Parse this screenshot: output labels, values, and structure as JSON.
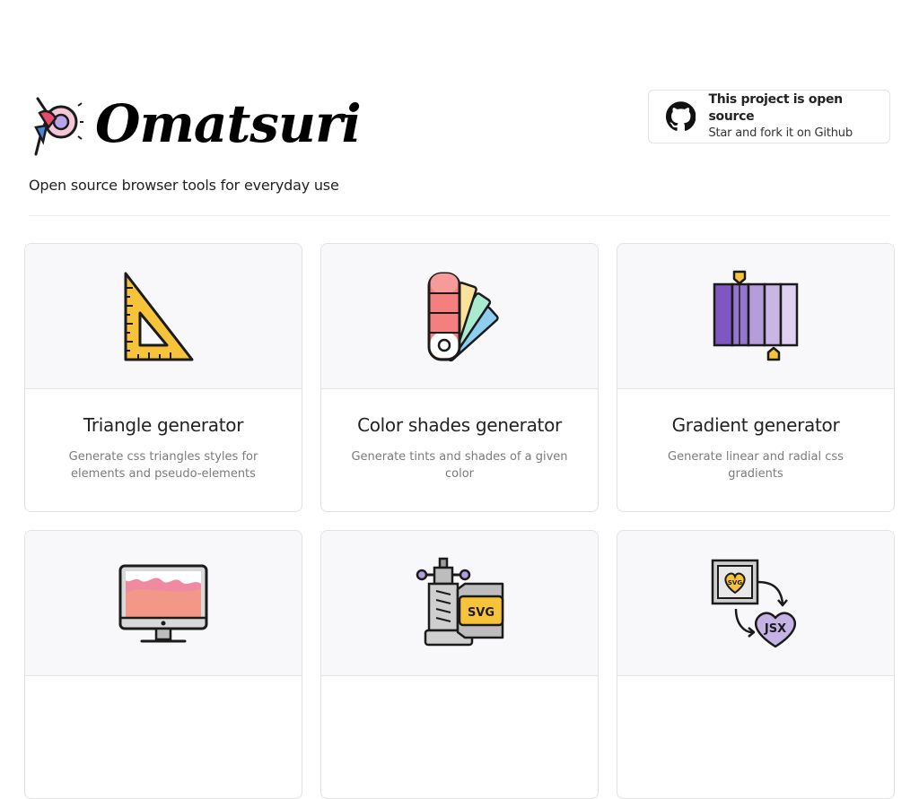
{
  "brand": {
    "name": "Omatsuri",
    "tagline": "Open source browser tools for everyday use"
  },
  "github": {
    "title": "This project is open source",
    "subtitle": "Star and fork it on Github",
    "icon": "github-icon"
  },
  "colors": {
    "card_bg": "#ffffff",
    "card_top_bg": "#f8f8fa",
    "border": "#e2e2e2",
    "desc_text": "#7b7b7b"
  },
  "tools": [
    {
      "title": "Triangle generator",
      "description": "Generate css triangles styles for elements and pseudo-elements",
      "icon": "set-square-icon"
    },
    {
      "title": "Color shades generator",
      "description": "Generate tints and shades of a given color",
      "icon": "color-swatch-fan-icon"
    },
    {
      "title": "Gradient generator",
      "description": "Generate linear and radial css gradients",
      "icon": "gradient-bars-icon"
    },
    {
      "title": "",
      "description": "",
      "icon": "monitor-icon"
    },
    {
      "title": "",
      "description": "",
      "icon": "svg-compressor-clamp-icon"
    },
    {
      "title": "",
      "description": "",
      "icon": "svg-to-jsx-heart-icon"
    }
  ]
}
